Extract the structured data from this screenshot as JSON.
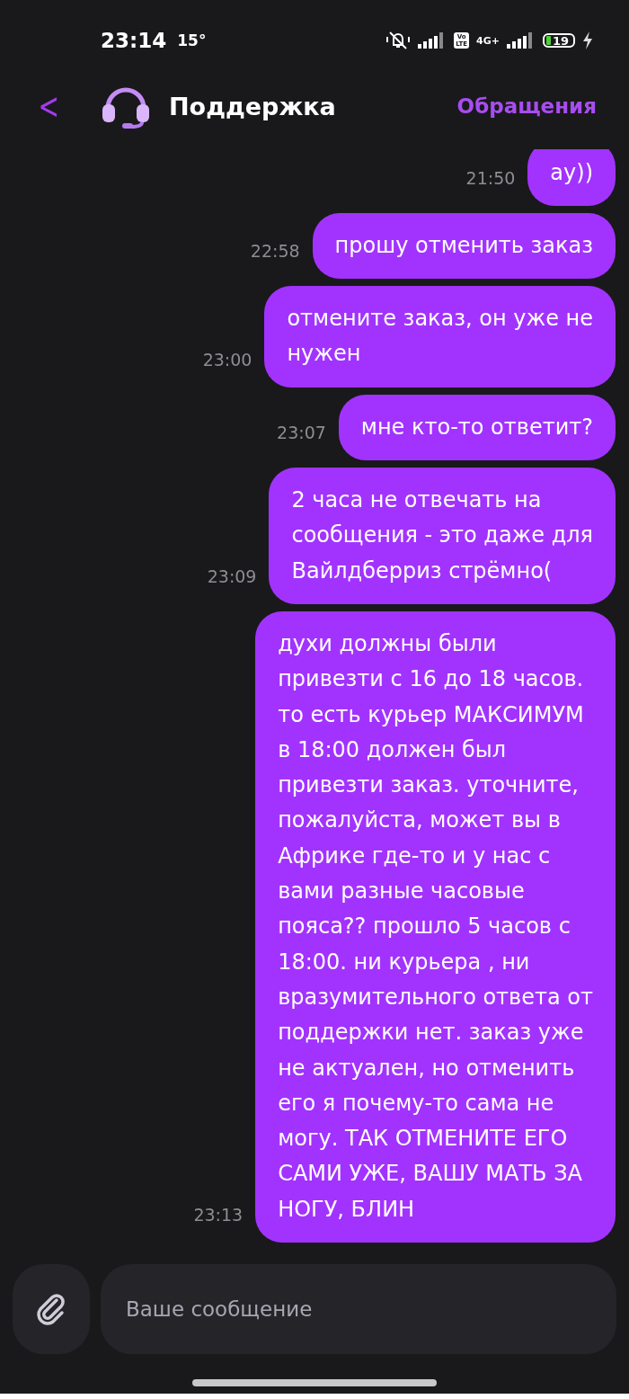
{
  "status_bar": {
    "time": "23:14",
    "temperature": "15°",
    "volte_badge": [
      "Vo",
      "LTE"
    ],
    "network": "4G+",
    "battery": "19"
  },
  "header": {
    "back": "<",
    "title": "Поддержка",
    "action": "Обращения"
  },
  "messages": [
    {
      "time": "21:50",
      "text": "ау))"
    },
    {
      "time": "22:58",
      "text": "прошу отменить заказ"
    },
    {
      "time": "23:00",
      "text": "отмените заказ, он уже не\nнужен"
    },
    {
      "time": "23:07",
      "text": "мне кто-то ответит?"
    },
    {
      "time": "23:09",
      "text": "2 часа не отвечать на\nсообщения - это даже для\nВайлдберриз стрёмно("
    },
    {
      "time": "23:13",
      "text": "духи должны были\nпривезти с 16 до 18 часов.\nто есть курьер МАКСИМУМ\nв 18:00 должен был\nпривезти заказ. уточните,\nпожалуйста, может вы в\nАфрике где-то и у нас с\nвами разные часовые\nпояса?? прошло 5 часов с\n18:00. ни курьера , ни\nвразумительного ответа от\nподдержки нет. заказ уже\nне актуален, но отменить\nего я почему-то сама не\nмогу. ТАК ОТМЕНИТЕ ЕГО\nСАМИ УЖЕ, ВАШУ МАТЬ ЗА\nНОГУ, БЛИН"
    }
  ],
  "composer": {
    "placeholder": "Ваше сообщение"
  }
}
